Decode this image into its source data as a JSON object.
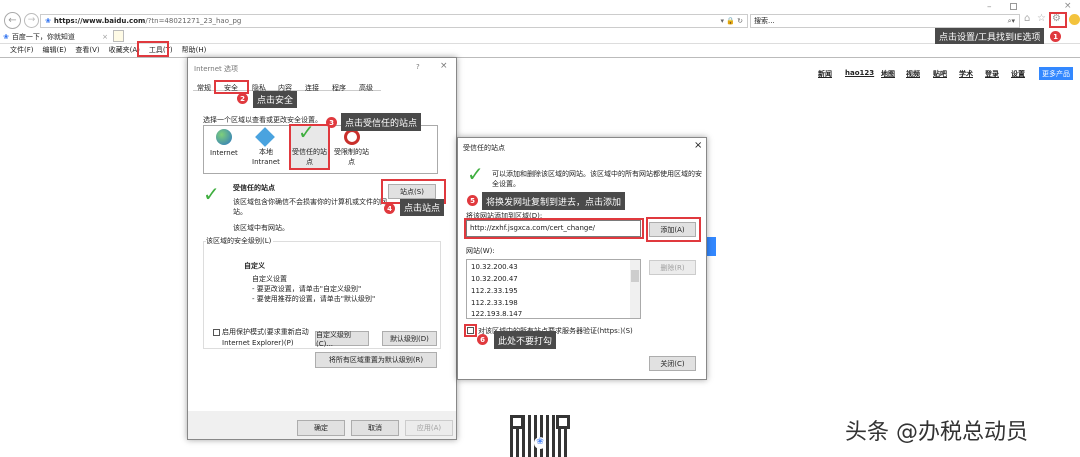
{
  "browser": {
    "url_prefix": "https://www.",
    "url_domain": "baidu.com",
    "url_rest": "/?tn=48021271_23_hao_pg",
    "search_placeholder": "搜索...",
    "tab_title": "百度一下，你就知道",
    "menu": [
      "文件(F)",
      "编辑(E)",
      "查看(V)",
      "收藏夹(A)",
      "工具(T)",
      "帮助(H)"
    ]
  },
  "baidu": {
    "links": [
      "新闻",
      "hao123",
      "地图",
      "视频",
      "贴吧",
      "学术",
      "登录",
      "设置"
    ],
    "more": "更多产品"
  },
  "annotations": [
    {
      "num": "1",
      "text": "点击设置/工具找到IE选项"
    },
    {
      "num": "2",
      "text": "点击安全"
    },
    {
      "num": "3",
      "text": "点击受信任的站点"
    },
    {
      "num": "4",
      "text": "点击站点"
    },
    {
      "num": "5",
      "text": "将换发网址复制到进去，点击添加"
    },
    {
      "num": "6",
      "text": "此处不要打勾"
    }
  ],
  "options": {
    "title": "Internet 选项",
    "help": "?",
    "close": "×",
    "tabs": [
      "常规",
      "安全",
      "隐私",
      "内容",
      "连接",
      "程序",
      "高级"
    ],
    "prompt": "选择一个区域以查看或更改安全设置。",
    "zones": [
      "Internet",
      "本地\nIntranet",
      "受信任的站\n点",
      "受限制的站\n点"
    ],
    "zone_title": "受信任的站点",
    "zone_desc": "该区域包含你确信不会损害你的计算机或文件的网\n站。",
    "zone_has": "该区域中有网站。",
    "sites_btn": "站点(S)",
    "level_label": "该区域的安全级别(L)",
    "custom": "自定义",
    "custom_lines": [
      "自定义设置",
      "- 要更改设置，请单击\"自定义级别\"",
      "- 要使用推荐的设置，请单击\"默认级别\""
    ],
    "protect": "启用保护模式(要求重新启动\nInternet Explorer)(P)",
    "custom_btn": "自定义级别(C)...",
    "default_btn": "默认级别(D)",
    "reset_btn": "将所有区域重置为默认级别(R)",
    "ok": "确定",
    "cancel": "取消",
    "apply": "应用(A)"
  },
  "trusted": {
    "title": "受信任的站点",
    "close": "×",
    "desc": "可以添加和删除该区域的网站。该区域中的所有网站都使用区域的安\n全设置。",
    "add_label": "将该网站添加到区域(D):",
    "input_value": "http://zxhf.jsgxca.com/cert_change/",
    "add_btn": "添加(A)",
    "sites_label": "网站(W):",
    "sites": [
      "10.32.200.43",
      "10.32.200.47",
      "112.2.33.195",
      "112.2.33.198",
      "122.193.8.147"
    ],
    "remove_btn": "删除(R)",
    "https_check": "对该区域中的所有站点要求服务器验证(https:)(S)",
    "close_btn": "关闭(C)"
  },
  "watermark": "头条 @办税总动员"
}
